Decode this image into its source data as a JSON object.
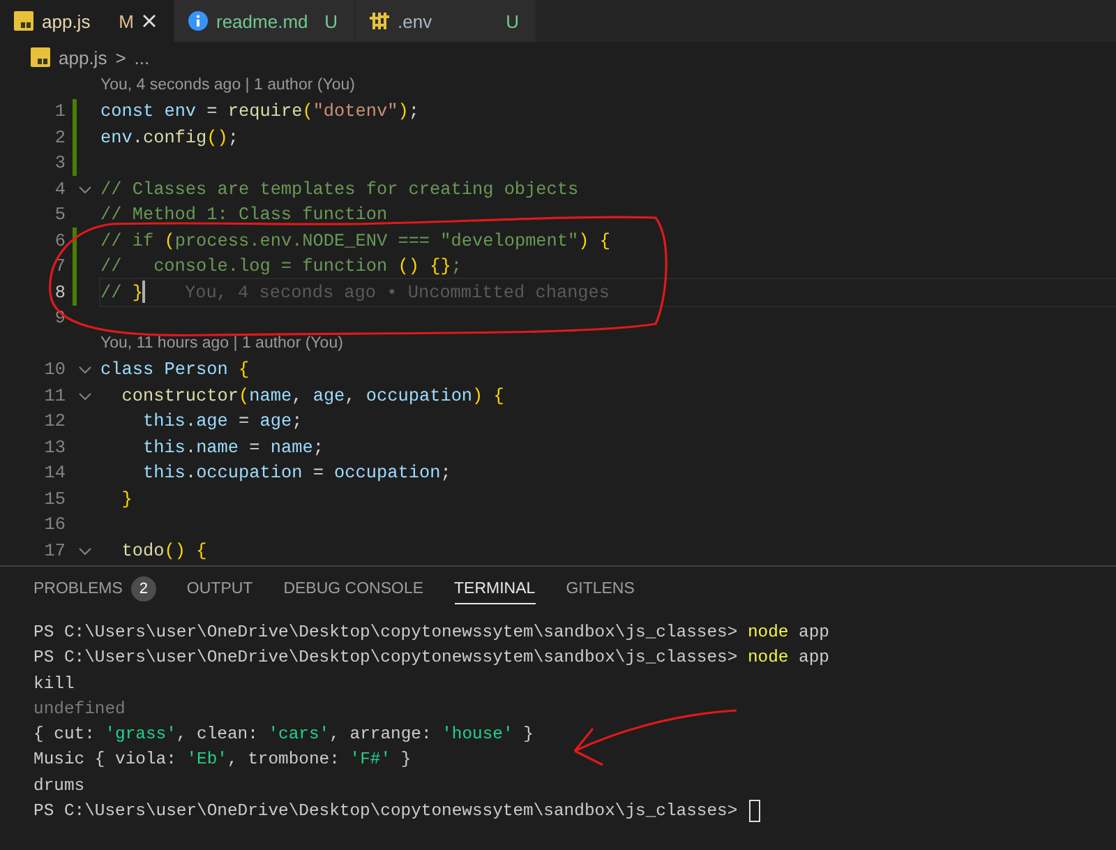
{
  "tabs": [
    {
      "label": "app.js",
      "status": "M",
      "selected": true
    },
    {
      "label": "readme.md",
      "status": "U",
      "selected": false
    },
    {
      "label": ".env",
      "status": "U",
      "selected": false
    }
  ],
  "breadcrumb": {
    "file": "app.js",
    "separator": ">",
    "more": "..."
  },
  "editor": {
    "lines": [
      {
        "kind": "blame",
        "text": "You, 4 seconds ago | 1 author (You)"
      },
      {
        "kind": "code",
        "number": "1",
        "changed": true,
        "fold": false,
        "current": false,
        "text": "const env = require(\"dotenv\");"
      },
      {
        "kind": "code",
        "number": "2",
        "changed": true,
        "fold": false,
        "current": false,
        "text": "env.config();"
      },
      {
        "kind": "code",
        "number": "3",
        "changed": true,
        "fold": false,
        "current": false
      },
      {
        "kind": "code",
        "number": "4",
        "changed": false,
        "fold": true,
        "current": false,
        "text": "// Classes are templates for creating objects"
      },
      {
        "kind": "code",
        "number": "5",
        "changed": false,
        "fold": false,
        "current": false,
        "text": "// Method 1: Class function"
      },
      {
        "kind": "code",
        "number": "6",
        "changed": true,
        "fold": false,
        "current": false,
        "text": "// if (process.env.NODE_ENV === \"development\") {"
      },
      {
        "kind": "code",
        "number": "7",
        "changed": true,
        "fold": false,
        "current": false,
        "text": "//   console.log = function () {};"
      },
      {
        "kind": "code",
        "number": "8",
        "changed": true,
        "fold": false,
        "current": true,
        "text": "// }",
        "after": "You, 4 seconds ago • Uncommitted changes"
      },
      {
        "kind": "code",
        "number": "9",
        "changed": false,
        "fold": false,
        "current": false
      },
      {
        "kind": "blame",
        "text": "You, 11 hours ago | 1 author (You)"
      },
      {
        "kind": "code",
        "number": "10",
        "changed": false,
        "fold": true,
        "current": false,
        "text": "class Person {"
      },
      {
        "kind": "code",
        "number": "11",
        "changed": false,
        "fold": true,
        "current": false,
        "text": "  constructor(name, age, occupation) {"
      },
      {
        "kind": "code",
        "number": "12",
        "changed": false,
        "fold": false,
        "current": false,
        "text": "    this.age = age;"
      },
      {
        "kind": "code",
        "number": "13",
        "changed": false,
        "fold": false,
        "current": false,
        "text": "    this.name = name;"
      },
      {
        "kind": "code",
        "number": "14",
        "changed": false,
        "fold": false,
        "current": false,
        "text": "    this.occupation = occupation;"
      },
      {
        "kind": "code",
        "number": "15",
        "changed": false,
        "fold": false,
        "current": false,
        "text": "  }"
      },
      {
        "kind": "code",
        "number": "16",
        "changed": false,
        "fold": false,
        "current": false
      },
      {
        "kind": "code",
        "number": "17",
        "changed": false,
        "fold": true,
        "current": false,
        "text": "  todo() {"
      }
    ]
  },
  "panel": {
    "tabs": [
      {
        "label": "PROBLEMS",
        "badge": "2",
        "selected": false
      },
      {
        "label": "OUTPUT",
        "selected": false
      },
      {
        "label": "DEBUG CONSOLE",
        "selected": false
      },
      {
        "label": "TERMINAL",
        "selected": true
      },
      {
        "label": "GITLENS",
        "selected": false
      }
    ],
    "terminal": [
      {
        "text": "PS C:\\Users\\user\\OneDrive\\Desktop\\copytonewssytem\\sandbox\\js_classes> node app",
        "muted": false,
        "cursor": false
      },
      {
        "text": "PS C:\\Users\\user\\OneDrive\\Desktop\\copytonewssytem\\sandbox\\js_classes> node app",
        "muted": false,
        "cursor": false
      },
      {
        "text": "kill",
        "muted": false,
        "cursor": false
      },
      {
        "text": "undefined",
        "muted": true,
        "cursor": false
      },
      {
        "text": "{ cut: 'grass', clean: 'cars', arrange: 'house' }",
        "muted": false,
        "cursor": false
      },
      {
        "text": "Music { viola: 'Eb', trombone: 'F#' }",
        "muted": false,
        "cursor": false
      },
      {
        "text": "drums",
        "muted": false,
        "cursor": false
      },
      {
        "text": "PS C:\\Users\\user\\OneDrive\\Desktop\\copytonewssytem\\sandbox\\js_classes>",
        "muted": false,
        "cursor": true
      }
    ]
  }
}
